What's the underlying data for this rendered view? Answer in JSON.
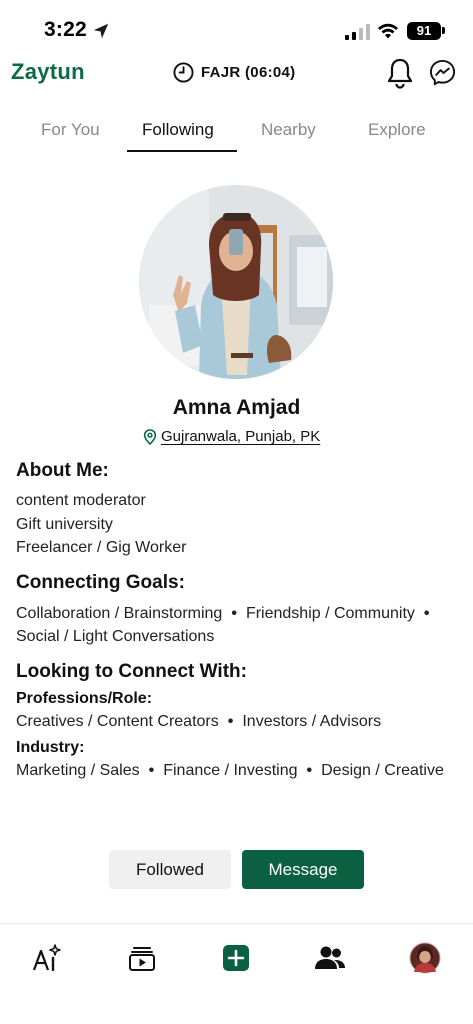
{
  "status_bar": {
    "time": "3:22",
    "battery": "91"
  },
  "header": {
    "brand": "Zaytun",
    "prayer": "FAJR (06:04)"
  },
  "tabs": [
    {
      "label": "For You",
      "active": false
    },
    {
      "label": "Following",
      "active": true
    },
    {
      "label": "Nearby",
      "active": false
    },
    {
      "label": "Explore",
      "active": false
    }
  ],
  "profile": {
    "name": "Amna Amjad",
    "location": "Gujranwala, Punjab, PK"
  },
  "about": {
    "title": "About Me:",
    "lines": [
      "content moderator",
      "Gift university",
      "Freelancer / Gig Worker"
    ]
  },
  "goals": {
    "title": "Connecting Goals:",
    "items": [
      "Collaboration / Brainstorming",
      "Friendship / Community",
      "Social / Light Conversations"
    ]
  },
  "looking": {
    "title": "Looking to Connect With:",
    "professions_title": "Professions/Role:",
    "professions": [
      "Creatives / Content Creators",
      "Investors / Advisors"
    ],
    "industry_title": "Industry:",
    "industry": [
      "Marketing / Sales",
      "Finance / Investing",
      "Design / Creative"
    ]
  },
  "actions": {
    "followed": "Followed",
    "message": "Message"
  },
  "colors": {
    "brand": "#0d6b43",
    "message_button": "#0b6041",
    "followed_button": "#f0f0f0"
  },
  "bottom_nav": [
    "ai-sparkle-icon",
    "video-feed-icon",
    "add-post-icon",
    "people-icon",
    "profile-avatar"
  ]
}
